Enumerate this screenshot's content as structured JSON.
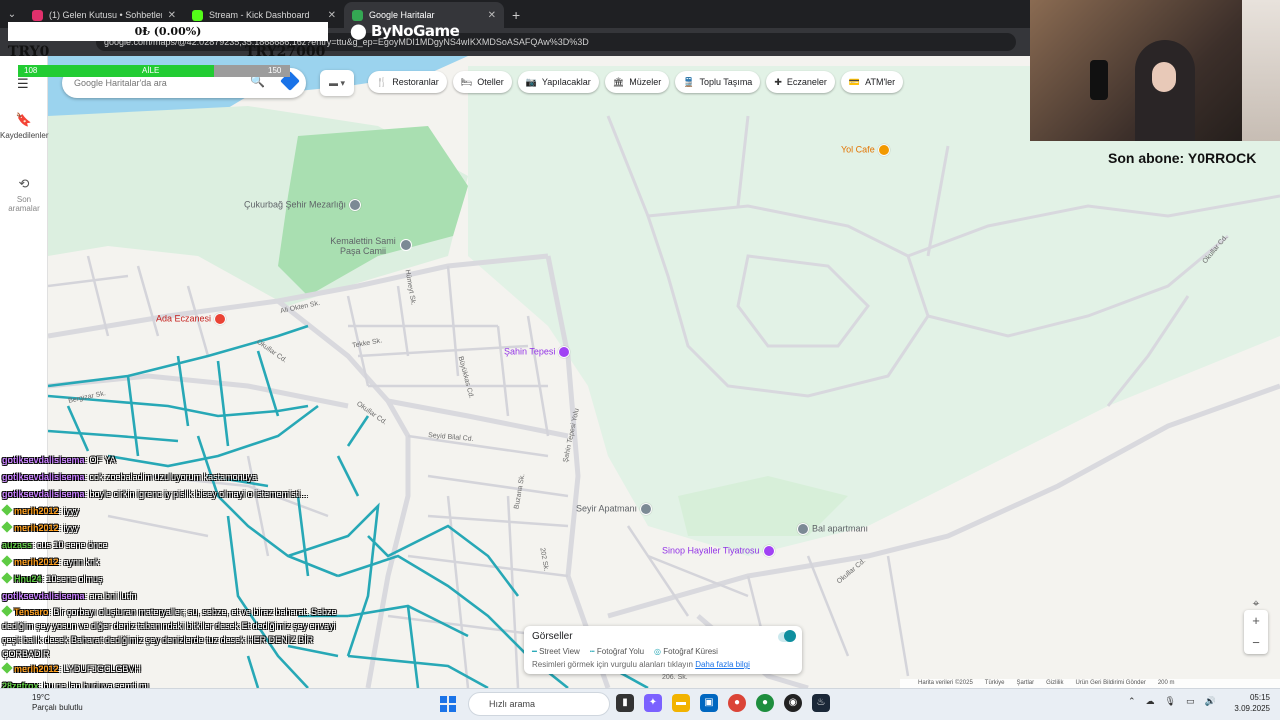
{
  "browser": {
    "tabs": [
      {
        "title": "(1) Gelen Kutusu • Sohbetler",
        "color": "#e1306c"
      },
      {
        "title": "Stream - Kick Dashboard",
        "color": "#53fc18"
      },
      {
        "title": "Google Haritalar",
        "color": "#34a853"
      }
    ],
    "url": "google.com/maps/@42.02879235,35.1868686,16z?entry=ttu&g_ep=EgoyMDI1MDgyNS4wIKXMDSoASAFQAw%3D%3D"
  },
  "overlay": {
    "donation": "0₺ (0.00%)",
    "try_left": "TRY0",
    "try_right": "TRY27000",
    "sponsor": "ByNoGame",
    "goal": {
      "left": "108",
      "center": "AİLE",
      "right": "150",
      "fraction": 0.72
    },
    "subscriber": "Son abone: Y0RROCK"
  },
  "rail": {
    "saved": "Kaydedilenler",
    "recent": "Son aramalar"
  },
  "search": {
    "placeholder": "Google Haritalar'da ara"
  },
  "chips": [
    {
      "icon": "🍴",
      "label": "Restoranlar"
    },
    {
      "icon": "🛏",
      "label": "Oteller"
    },
    {
      "icon": "📷",
      "label": "Yapılacaklar"
    },
    {
      "icon": "🏛",
      "label": "Müzeler"
    },
    {
      "icon": "🚆",
      "label": "Toplu Taşıma"
    },
    {
      "icon": "✚",
      "label": "Eczaneler"
    },
    {
      "icon": "💳",
      "label": "ATM'ler"
    }
  ],
  "places": {
    "mezarlik": "Çukurbağ Şehir Mezarlığı",
    "kemalettin": "Kemalettin Sami Paşa Camii",
    "eczane": "Ada Eczanesi",
    "tepe": "Şahin Tepesi",
    "cafe": "Yol Cafe",
    "seyir": "Seyir Apatmanı",
    "bal": "Bal apartmanı",
    "tiyatro": "Sinop Hayaller Tiyatrosu"
  },
  "streets": {
    "ali_okten": "Ali Okten Sk.",
    "humeyt": "Hümeyt Sk.",
    "tekke": "Tekke Sk.",
    "buyukkas": "Büyükkas Cd.",
    "okullar1": "Okullar Cd.",
    "okullar2": "Okullar Cd.",
    "okullar3": "Okullar Cd.",
    "okullar4": "Okullar Cd.",
    "seyid": "Seyid Bilal Cd.",
    "sahin_yolu": "Şahin Tepesi Yolu",
    "buzana": "Buzana Sk.",
    "s202": "202 Sk.",
    "s206": "206. Sk.",
    "bergizar": "Bergizar Sk."
  },
  "gorseller": {
    "title": "Görseller",
    "legend": [
      "Street View",
      "Fotoğraf Yolu",
      "Fotoğraf Küresi"
    ],
    "hint": "Resimleri görmek için vurgulu alanları tıklayın",
    "link": "Daha fazla bilgi"
  },
  "attribution": [
    "Harita verileri ©2025",
    "Türkiye",
    "Şartlar",
    "Gizlilik",
    "Ürün Geri Bildirimi Gönder",
    "200 m"
  ],
  "chat": [
    {
      "user": "gotiksevdalisisema",
      "color": "#c77dff",
      "badge": false,
      "text": ": OF YA"
    },
    {
      "user": "gotiksevdalisisema",
      "color": "#c77dff",
      "badge": false,
      "text": ": cok zoebaladim uzuluyorum kastamonuya"
    },
    {
      "user": "gotiksevdalisisema",
      "color": "#c77dff",
      "badge": false,
      "text": ": boyle cirkin igrenc iy pislik bisey olmayi o istememisti..."
    },
    {
      "user": "merih2012",
      "color": "#ff9f1c",
      "badge": true,
      "text": ": iyyy"
    },
    {
      "user": "merih2012",
      "color": "#ff9f1c",
      "badge": true,
      "text": ": iyyy"
    },
    {
      "user": "auzass",
      "color": "#5ecb43",
      "badge": false,
      "text": ": cus 10 sene önce"
    },
    {
      "user": "merih2012",
      "color": "#ff9f1c",
      "badge": true,
      "text": ": aynn knk"
    },
    {
      "user": "Hnu24",
      "color": "#5ecb43",
      "badge": true,
      "text": ": 10sene olmuş"
    },
    {
      "user": "gotiksevdalisisema",
      "color": "#c77dff",
      "badge": false,
      "text": ": ara bni lutfn"
    },
    {
      "user": "Tensaro",
      "color": "#ff9f1c",
      "badge": true,
      "text": ": Bir çorbayı oluşturan materyaller; su, sebze, et ve biraz baharat. Sebze dediğim şey yosun ve diğer deniz tabanındaki bitkiler desek Et dediğimiz şey envayi çeşit balık desek Baharat dediğimiz şey denizlerde tuz desek HER DENİZ BİR ÇORBADIR"
    },
    {
      "user": "merih2012",
      "color": "#ff9f1c",
      "badge": true,
      "text": ": LYDUFJGCLGBVH"
    },
    {
      "user": "28zefrox",
      "color": "#5ecb43",
      "badge": false,
      "text": ": bu ne lan burjuva semti mı"
    }
  ],
  "taskbar": {
    "temp": "19°C",
    "weather": "Parçalı bulutlu",
    "search": "Hızlı arama",
    "time": "05:15",
    "date": "3.09.2025"
  }
}
